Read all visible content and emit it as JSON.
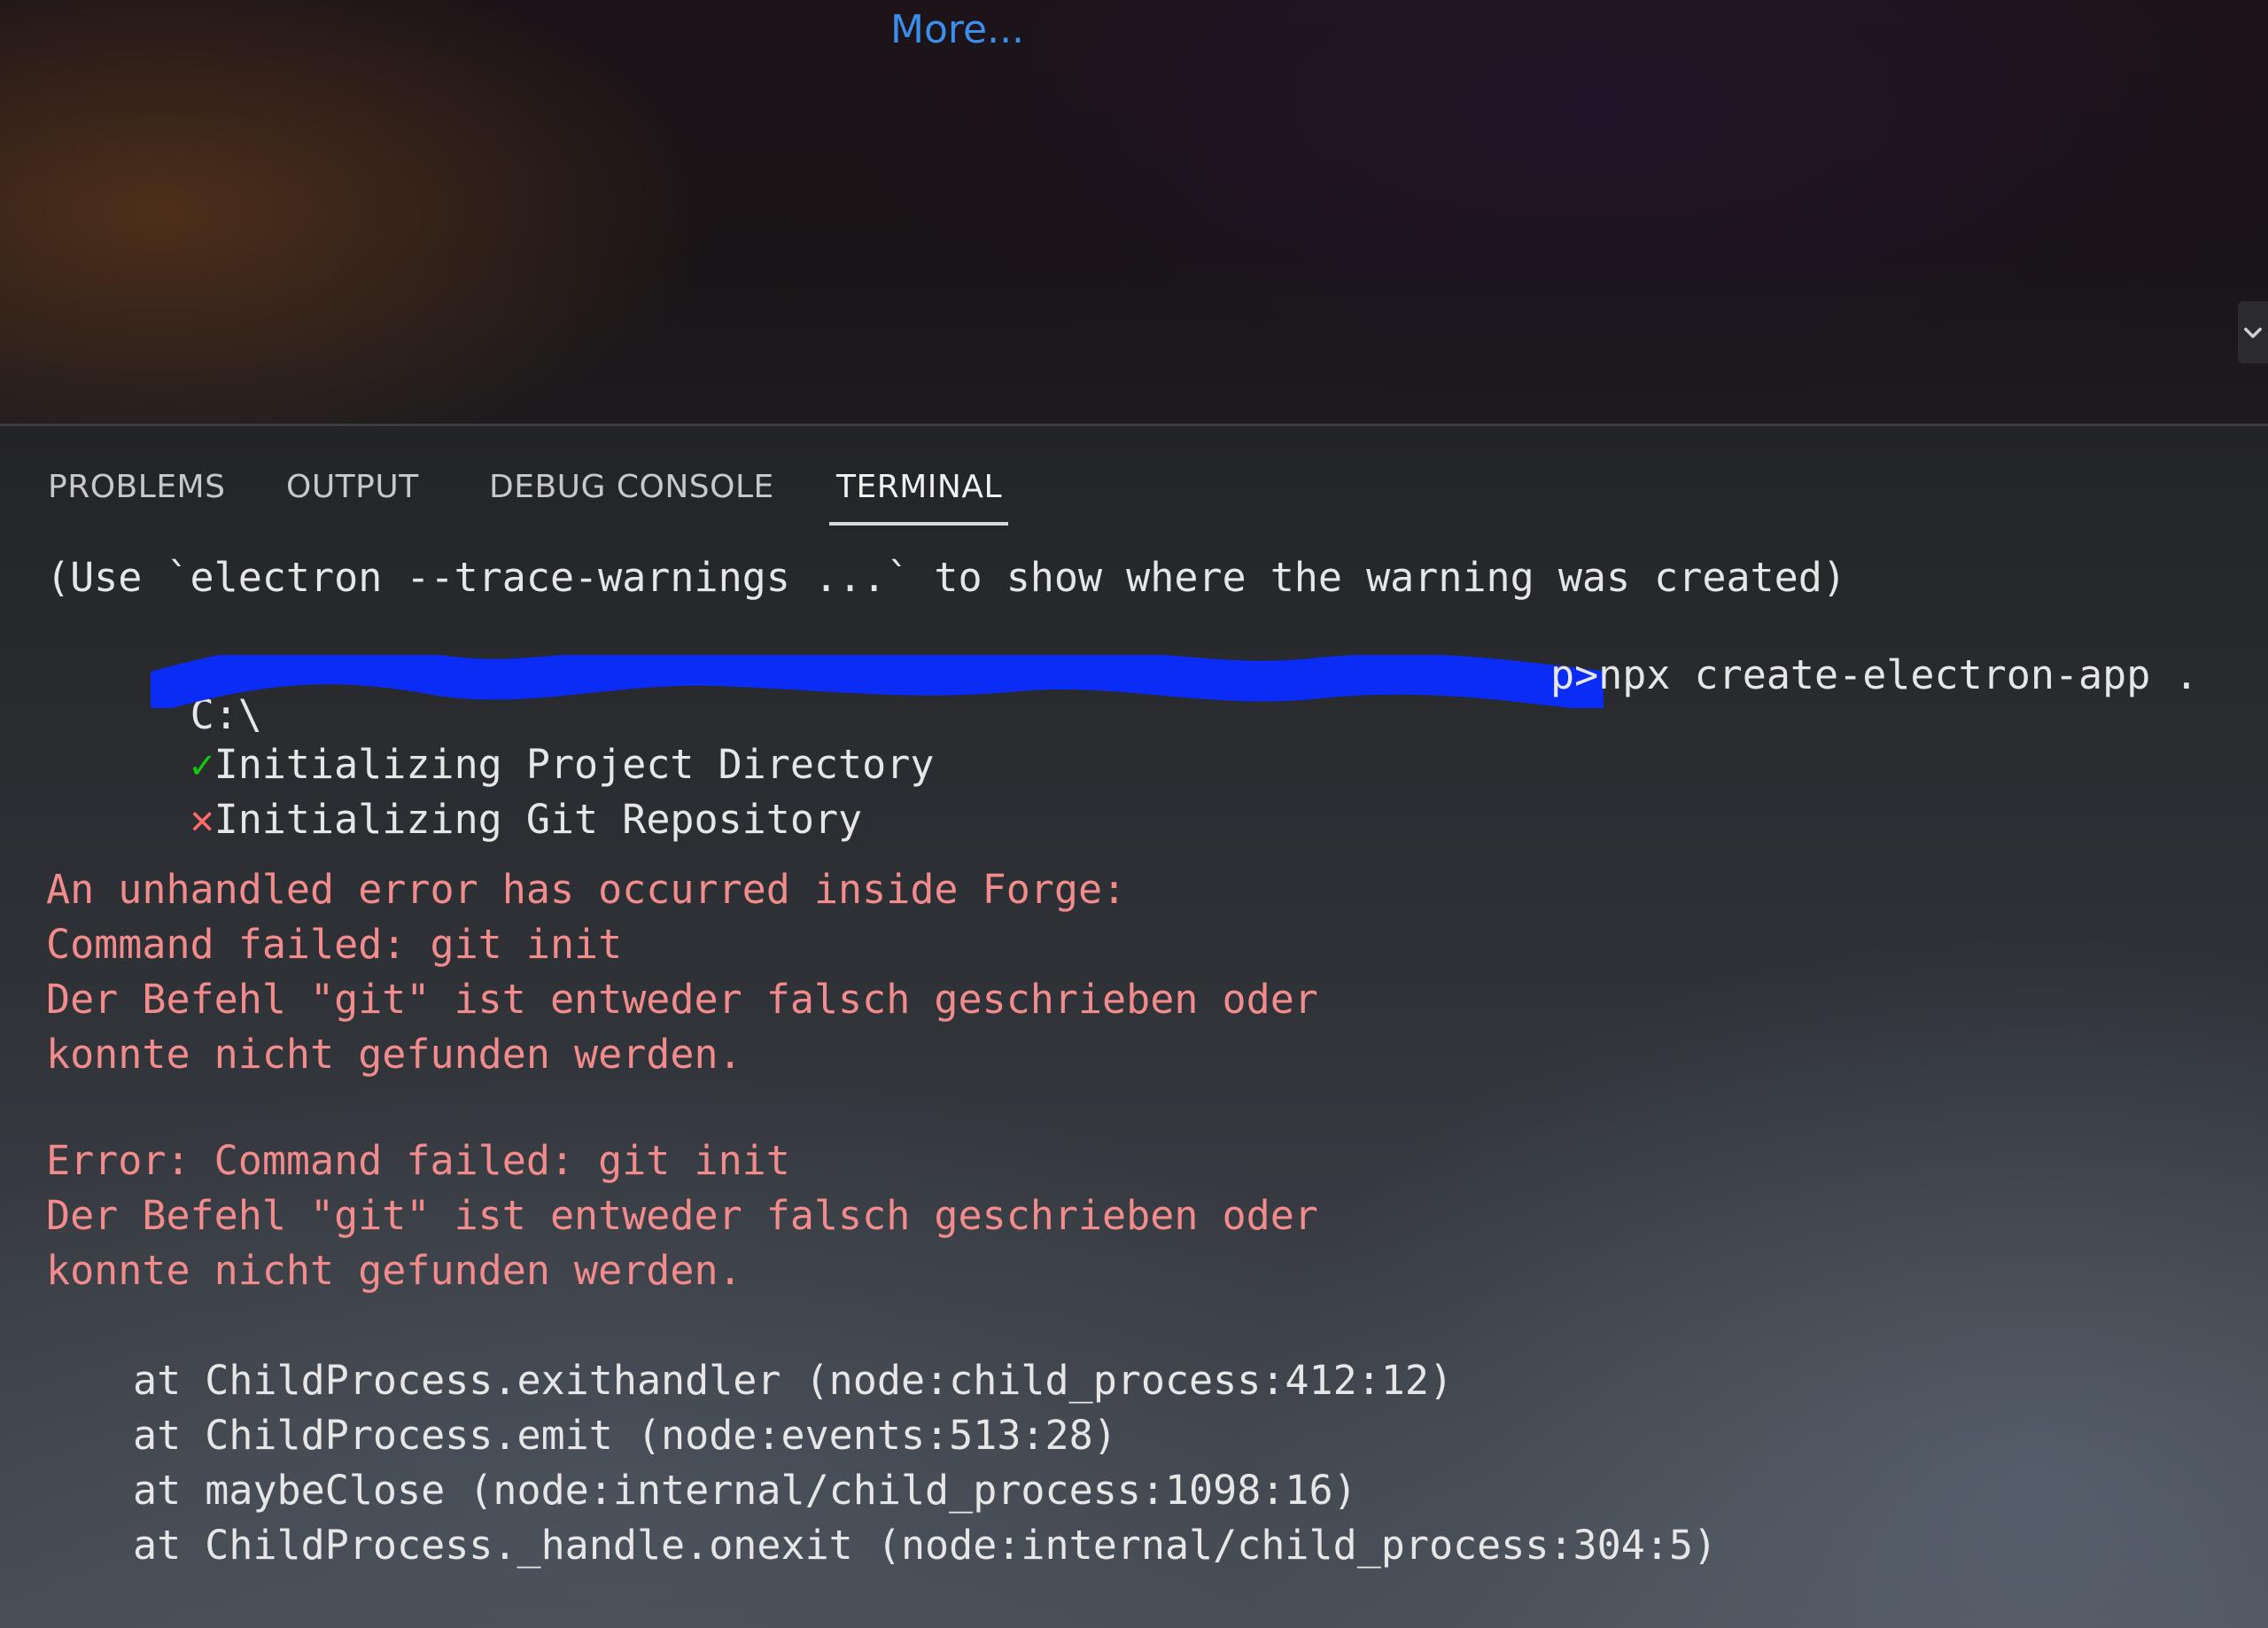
{
  "editor": {
    "more_link": "More...",
    "scroll_icon": "chevron-down-icon"
  },
  "panel": {
    "tabs": [
      {
        "label": "PROBLEMS",
        "active": false
      },
      {
        "label": "OUTPUT",
        "active": false
      },
      {
        "label": "DEBUG CONSOLE",
        "active": false
      },
      {
        "label": "TERMINAL",
        "active": true
      }
    ]
  },
  "terminal": {
    "warning_hint": "(Use `electron --trace-warnings ...` to show where the warning was created)",
    "prompt_drive": "C:\\",
    "prompt_suffix": "p>npx create-electron-app .",
    "step_ok_icon": "✓",
    "step_ok": "Initializing Project Directory",
    "step_fail_icon": "✕",
    "step_fail": "Initializing Git Repository",
    "error_lines_1": [
      "An unhandled error has occurred inside Forge:",
      "Command failed: git init",
      "Der Befehl \"git\" ist entweder falsch geschrieben oder",
      "konnte nicht gefunden werden."
    ],
    "error_lines_2": [
      "Error: Command failed: git init",
      "Der Befehl \"git\" ist entweder falsch geschrieben oder",
      "konnte nicht gefunden werden."
    ],
    "stack": [
      "at ChildProcess.exithandler (node:child_process:412:12)",
      "at ChildProcess.emit (node:events:513:28)",
      "at maybeClose (node:internal/child_process:1098:16)",
      "at ChildProcess._handle.onexit (node:internal/child_process:304:5)"
    ]
  },
  "colors": {
    "link": "#3b8eea",
    "error_text": "#f28b8b",
    "ok_icon": "#16c60c",
    "fail_icon": "#ff6b6b",
    "redaction": "#0a2cf5"
  }
}
